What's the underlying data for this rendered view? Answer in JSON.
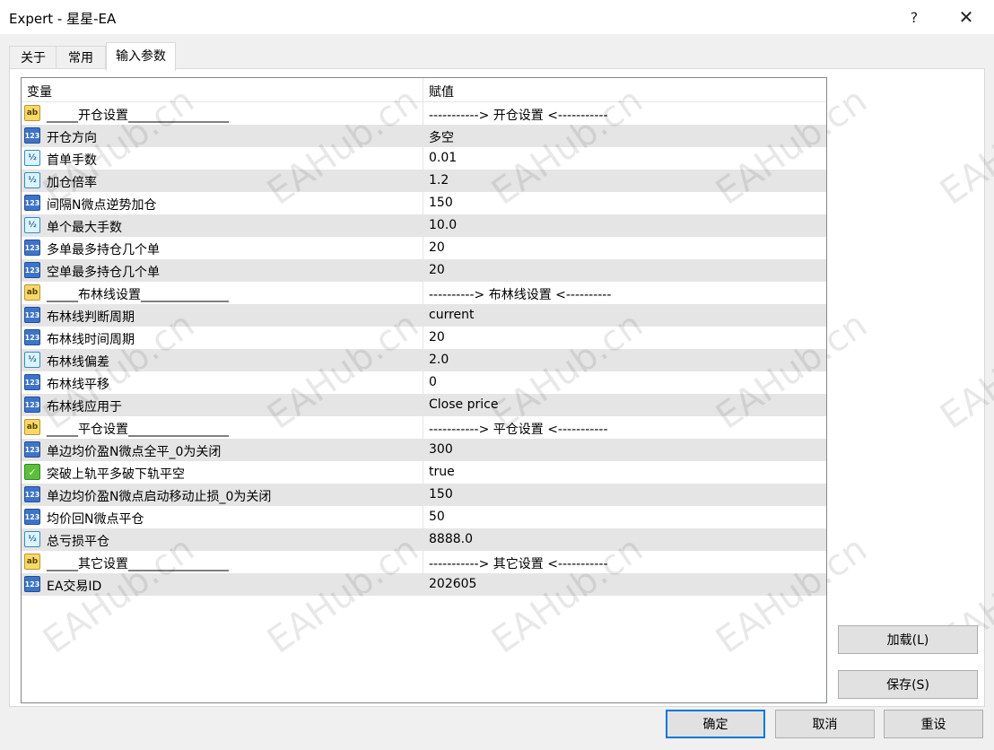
{
  "window": {
    "title": "Expert - 星星-EA",
    "help": "?",
    "close": "✕"
  },
  "tabs": [
    {
      "label": "关于",
      "active": false
    },
    {
      "label": "常用",
      "active": false
    },
    {
      "label": "输入参数",
      "active": true
    }
  ],
  "table": {
    "headers": {
      "variable": "变量",
      "value": "赋值"
    },
    "rows": [
      {
        "icon": "ab",
        "name": "_____开仓设置________________",
        "value": "-----------> 开仓设置 <-----------"
      },
      {
        "icon": "123",
        "name": "开仓方向",
        "value": "多空"
      },
      {
        "icon": "1/2",
        "name": "首单手数",
        "value": "0.01"
      },
      {
        "icon": "1/2",
        "name": "加仓倍率",
        "value": "1.2"
      },
      {
        "icon": "123",
        "name": "间隔N微点逆势加仓",
        "value": "150"
      },
      {
        "icon": "1/2",
        "name": "单个最大手数",
        "value": "10.0"
      },
      {
        "icon": "123",
        "name": "多单最多持仓几个单",
        "value": "20"
      },
      {
        "icon": "123",
        "name": "空单最多持仓几个单",
        "value": "20"
      },
      {
        "icon": "ab",
        "name": "_____布林线设置______________",
        "value": "----------> 布林线设置 <----------"
      },
      {
        "icon": "123",
        "name": "布林线判断周期",
        "value": "current"
      },
      {
        "icon": "123",
        "name": "布林线时间周期",
        "value": "20"
      },
      {
        "icon": "1/2",
        "name": "布林线偏差",
        "value": "2.0"
      },
      {
        "icon": "123",
        "name": "布林线平移",
        "value": "0"
      },
      {
        "icon": "123",
        "name": "布林线应用于",
        "value": "Close price"
      },
      {
        "icon": "ab",
        "name": "_____平仓设置________________",
        "value": "-----------> 平仓设置 <-----------"
      },
      {
        "icon": "123",
        "name": "单边均价盈N微点全平_0为关闭",
        "value": "300"
      },
      {
        "icon": "bool",
        "name": "突破上轨平多破下轨平空",
        "value": "true"
      },
      {
        "icon": "123",
        "name": "单边均价盈N微点启动移动止损_0为关闭",
        "value": "150"
      },
      {
        "icon": "123",
        "name": "均价回N微点平仓",
        "value": "50"
      },
      {
        "icon": "1/2",
        "name": "总亏损平仓",
        "value": "8888.0"
      },
      {
        "icon": "ab",
        "name": "_____其它设置________________",
        "value": "-----------> 其它设置 <-----------"
      },
      {
        "icon": "123",
        "name": "EA交易ID",
        "value": "202605"
      }
    ]
  },
  "watermark": "EAHub.cn",
  "buttons": {
    "load": "加载(L)",
    "save": "保存(S)",
    "ok": "确定",
    "cancel": "取消",
    "reset": "重设"
  }
}
